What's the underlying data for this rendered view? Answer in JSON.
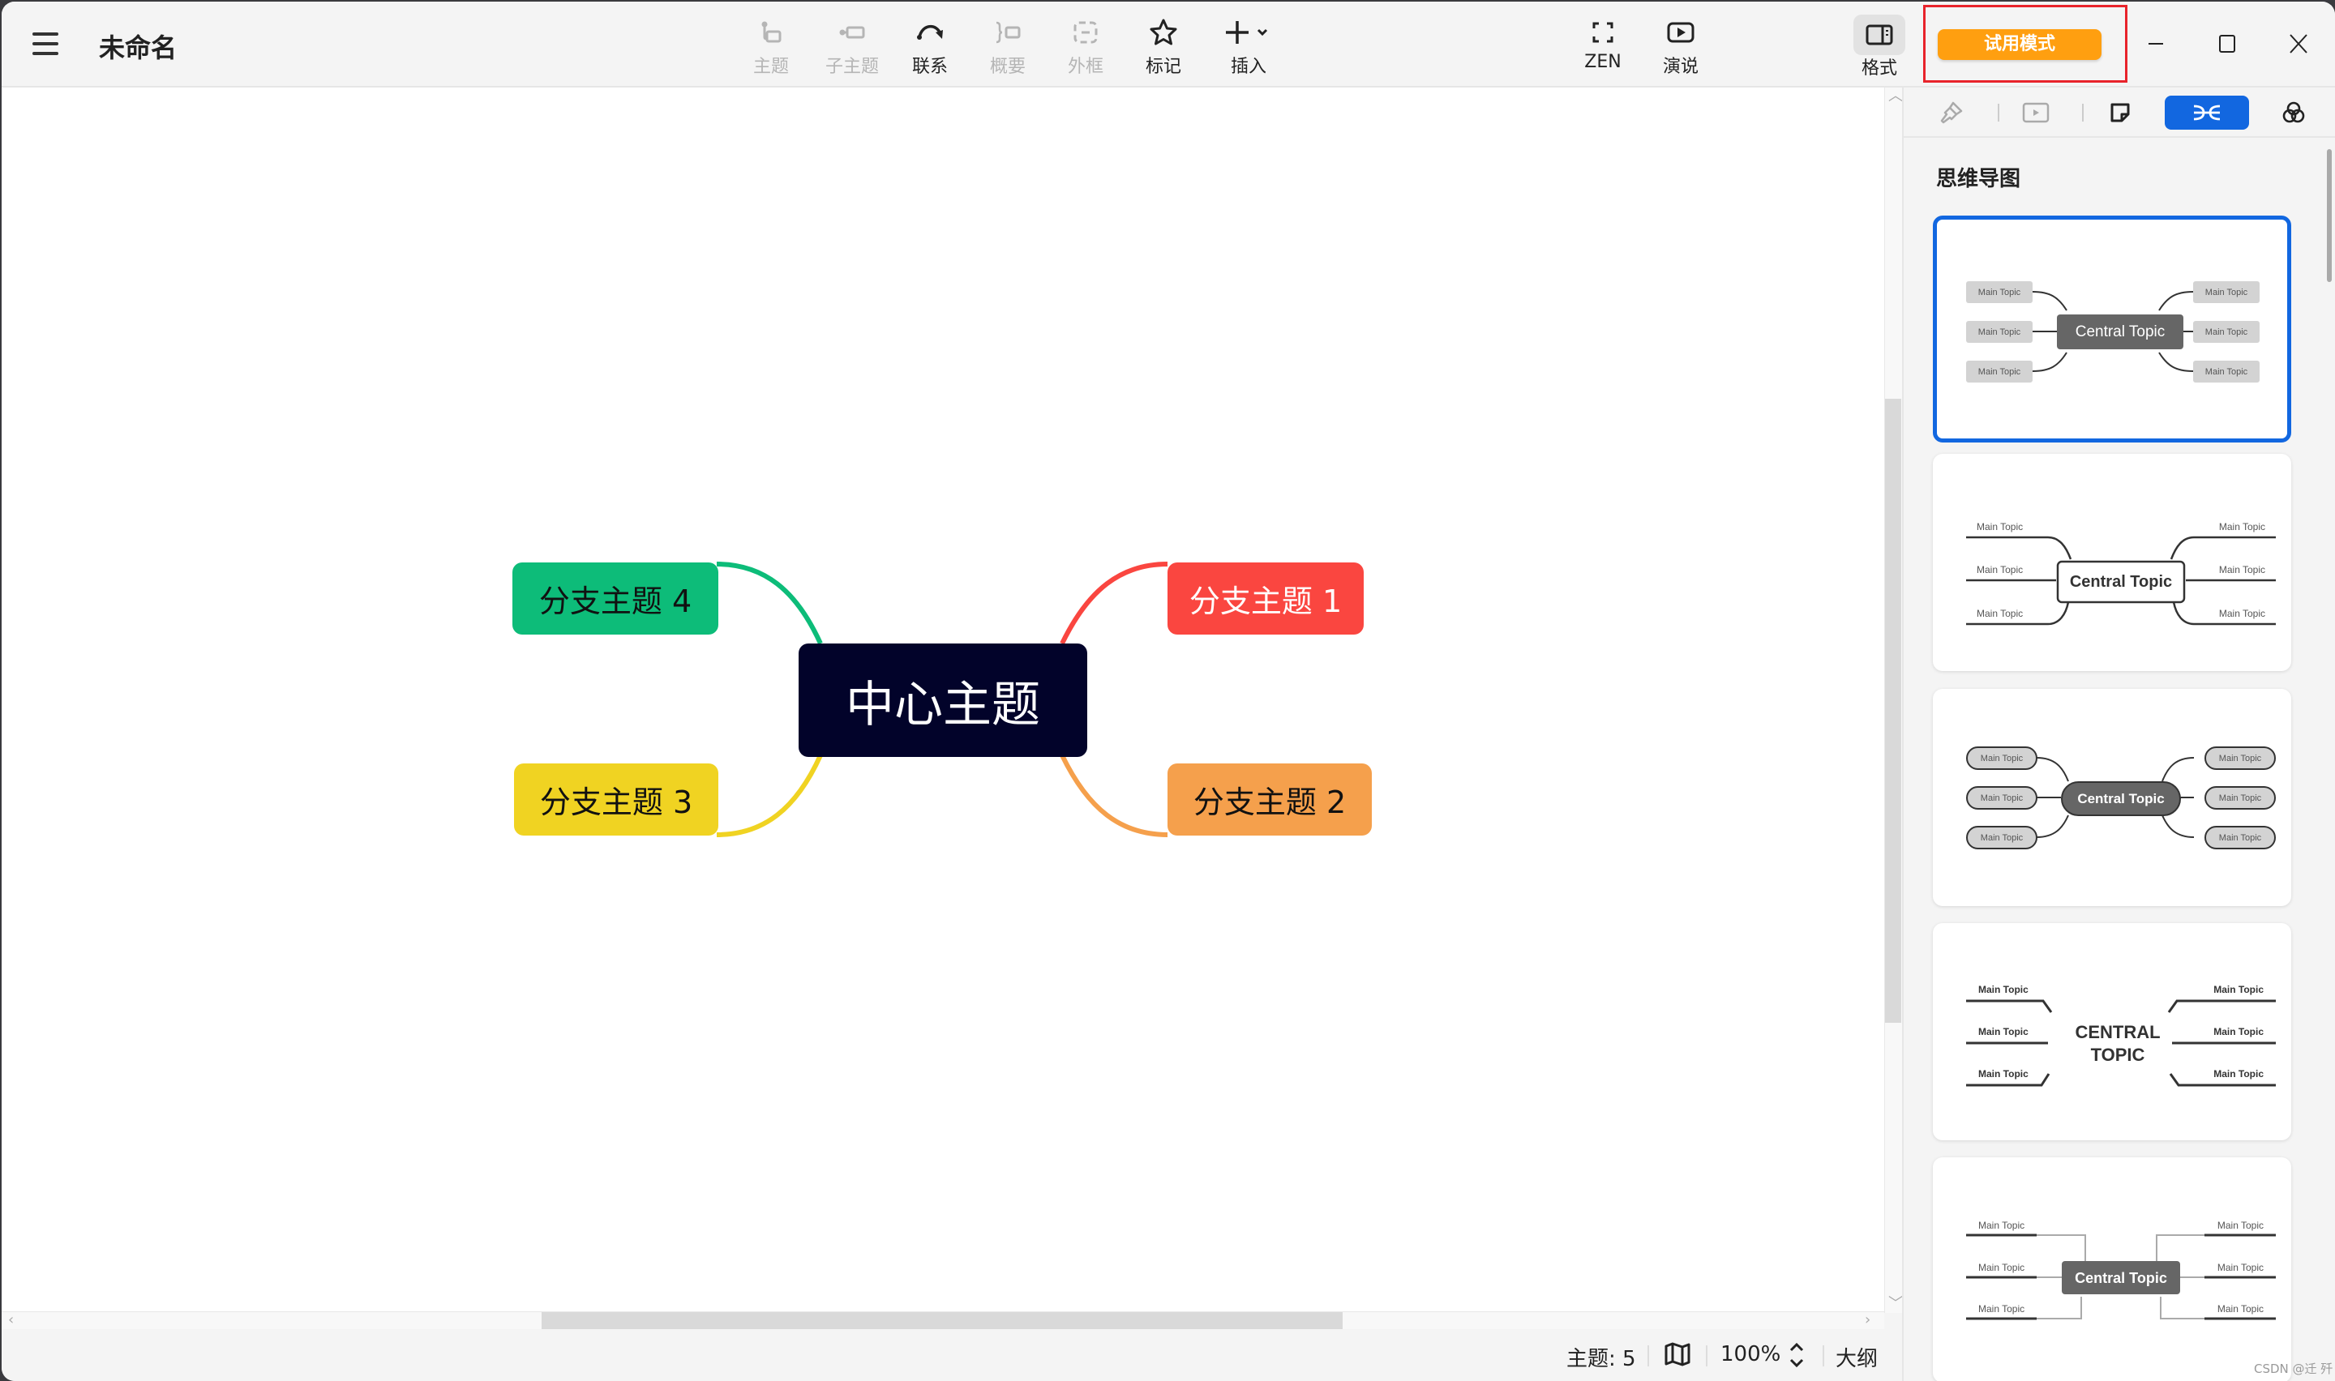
{
  "app": {
    "title": "未命名",
    "icons": {
      "menu": "hamburger-menu-icon"
    }
  },
  "toolbar": {
    "items": [
      {
        "id": "topic",
        "label": "主题",
        "icon": "topic-icon",
        "enabled": false
      },
      {
        "id": "subtopic",
        "label": "子主题",
        "icon": "subtopic-icon",
        "enabled": false
      },
      {
        "id": "relationship",
        "label": "联系",
        "icon": "relationship-arrow-icon",
        "enabled": true
      },
      {
        "id": "summary",
        "label": "概要",
        "icon": "summary-brace-icon",
        "enabled": false
      },
      {
        "id": "boundary",
        "label": "外框",
        "icon": "boundary-icon",
        "enabled": false
      },
      {
        "id": "marker",
        "label": "标记",
        "icon": "star-icon",
        "enabled": true
      },
      {
        "id": "insert",
        "label": "插入",
        "icon": "plus-icon",
        "enabled": true
      }
    ],
    "zen_label": "ZEN",
    "present_label": "演说",
    "format_label": "格式",
    "trial_label": "试用模式"
  },
  "window_controls": {
    "minimize": "minimize-icon",
    "maximize": "maximize-icon",
    "close": "close-icon"
  },
  "mindmap": {
    "central": {
      "label": "中心主题",
      "color": "#02032a",
      "text_color": "#ffffff"
    },
    "branches": [
      {
        "label": "分支主题 1",
        "color": "#fa4640",
        "text_color": "#ffffff",
        "side": "right"
      },
      {
        "label": "分支主题 2",
        "color": "#f5a04c",
        "text_color": "#111111",
        "side": "right"
      },
      {
        "label": "分支主题 3",
        "color": "#f0d322",
        "text_color": "#111111",
        "side": "left"
      },
      {
        "label": "分支主题 4",
        "color": "#0dbc79",
        "text_color": "#111111",
        "side": "left"
      }
    ]
  },
  "statusbar": {
    "topic_count": "主题: 5",
    "zoom": "100%",
    "outline_label": "大纲",
    "map_icon": "map-icon",
    "zoom_stepper_icon": "up-down-chevron-icon"
  },
  "panel": {
    "tabs": [
      {
        "id": "style",
        "icon": "paintbrush-icon",
        "enabled": false
      },
      {
        "id": "presentation",
        "icon": "play-screen-icon",
        "enabled": false
      },
      {
        "id": "sticker",
        "icon": "sticky-note-icon",
        "enabled": true
      },
      {
        "id": "structure",
        "icon": "mindmap-structure-icon",
        "active": true
      },
      {
        "id": "theme",
        "icon": "color-circles-icon",
        "enabled": true
      }
    ],
    "heading": "思维导图",
    "templates": [
      {
        "name": "Rounded rectangle gray",
        "central": "Central Topic",
        "topic": "Main Topic",
        "selected": true
      },
      {
        "name": "Underline with outlined central",
        "central": "Central Topic",
        "topic": "Main Topic",
        "selected": false
      },
      {
        "name": "Pill shapes",
        "central": "Central Topic",
        "topic": "Main Topic",
        "selected": false
      },
      {
        "name": "Angled lines text-only",
        "central": "CENTRAL TOPIC",
        "topic": "Main Topic",
        "selected": false
      },
      {
        "name": "Elbow connectors",
        "central": "Central Topic",
        "topic": "Main Topic",
        "selected": false
      }
    ]
  },
  "watermark": "CSDN @迁  歼"
}
